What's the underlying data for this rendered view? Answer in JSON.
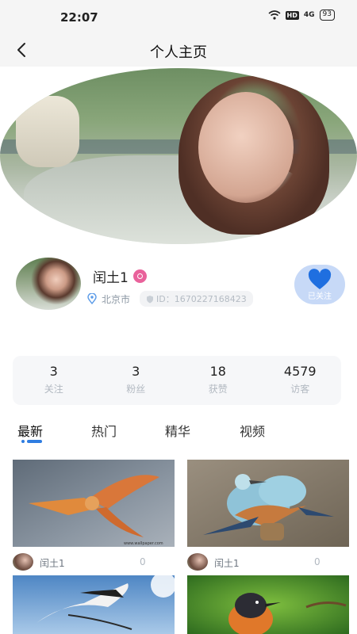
{
  "status_bar": {
    "time": "22:07",
    "network": "HD",
    "signal": "4G",
    "battery": "93"
  },
  "nav": {
    "title": "个人主页"
  },
  "profile": {
    "name": "闰土1",
    "location": "北京市",
    "id_text": "ID：1670227168423",
    "follow_label": "已关注"
  },
  "stats": [
    {
      "value": "3",
      "label": "关注"
    },
    {
      "value": "3",
      "label": "粉丝"
    },
    {
      "value": "18",
      "label": "获赞"
    },
    {
      "value": "4579",
      "label": "访客"
    }
  ],
  "tabs": [
    "最新",
    "热门",
    "精华",
    "视频"
  ],
  "active_tab": "最新",
  "posts": [
    {
      "author": "闰土1",
      "count": "0",
      "image": "flying-orange-bird"
    },
    {
      "author": "闰土1",
      "count": "0",
      "image": "blue-roller-birds"
    },
    {
      "author": "",
      "count": "",
      "image": "white-ibis-flying"
    },
    {
      "author": "",
      "count": "",
      "image": "robin-on-branch"
    }
  ],
  "colors": {
    "accent": "#2f7de1",
    "follow_bg": "#c7d9f7",
    "badge": "#e9629b"
  }
}
